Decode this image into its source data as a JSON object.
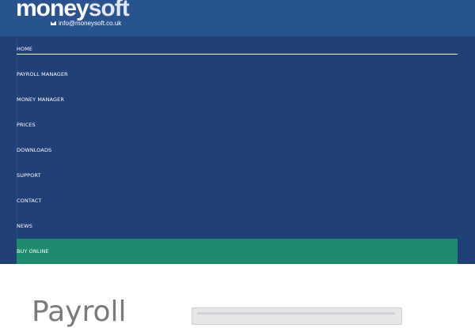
{
  "brand": {
    "logo_bold": "money",
    "logo_light": "soft",
    "email": "info@moneysoft.co.uk"
  },
  "nav": {
    "items": [
      {
        "label": "HOME",
        "active": true
      },
      {
        "label": "PAYROLL MANAGER"
      },
      {
        "label": "MONEY MANAGER"
      },
      {
        "label": "PRICES"
      },
      {
        "label": "DOWNLOADS"
      },
      {
        "label": "SUPPORT"
      },
      {
        "label": "CONTACT"
      },
      {
        "label": "NEWS"
      },
      {
        "label": "BUY ONLINE",
        "highlight": true
      }
    ]
  },
  "main": {
    "title": "Payroll"
  },
  "colors": {
    "header_bg": "#28538f",
    "nav_bg": "#1f4176",
    "buy_bg": "#1f8a6e",
    "title_text": "#7a7a7a"
  },
  "icons": {
    "email": "envelope-icon"
  }
}
